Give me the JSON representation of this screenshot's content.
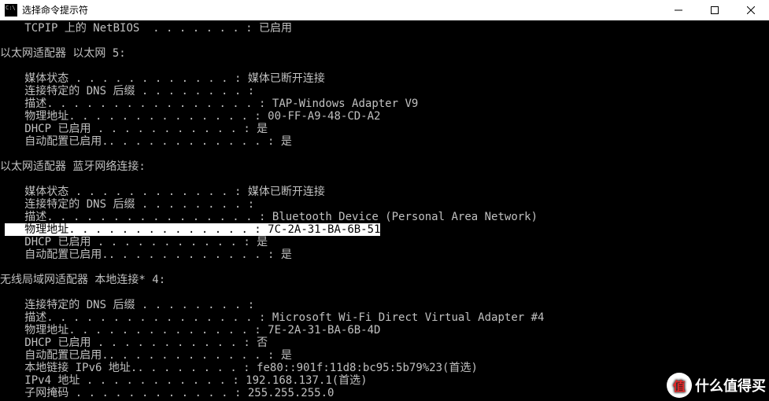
{
  "window": {
    "title": "选择命令提示符"
  },
  "top": {
    "netbios_label": "TCPIP 上的 NetBIOS",
    "netbios_value": "已启用"
  },
  "adapter_eth5": {
    "header": "以太网适配器 以太网 5:",
    "media_state_label": "媒体状态",
    "media_state_value": "媒体已断开连接",
    "dns_suffix_label": "连接特定的 DNS 后缀",
    "dns_suffix_value": "",
    "descr_label": "描述.",
    "descr_value": "TAP-Windows Adapter V9",
    "phys_label": "物理地址.",
    "phys_value": "00-FF-A9-48-CD-A2",
    "dhcp_label": "DHCP 已启用",
    "dhcp_value": "是",
    "autocfg_label": "自动配置已启用.",
    "autocfg_value": "是"
  },
  "adapter_bt": {
    "header": "以太网适配器 蓝牙网络连接:",
    "media_state_label": "媒体状态",
    "media_state_value": "媒体已断开连接",
    "dns_suffix_label": "连接特定的 DNS 后缀",
    "dns_suffix_value": "",
    "descr_label": "描述.",
    "descr_value": "Bluetooth Device (Personal Area Network)",
    "phys_label": "物理地址.",
    "phys_value": "7C-2A-31-BA-6B-51",
    "dhcp_label": "DHCP 已启用",
    "dhcp_value": "是",
    "autocfg_label": "自动配置已启用.",
    "autocfg_value": "是"
  },
  "adapter_wifi": {
    "header": "无线局域网适配器 本地连接* 4:",
    "dns_suffix_label": "连接特定的 DNS 后缀",
    "dns_suffix_value": "",
    "descr_label": "描述.",
    "descr_value": "Microsoft Wi-Fi Direct Virtual Adapter #4",
    "phys_label": "物理地址.",
    "phys_value": "7E-2A-31-BA-6B-4D",
    "dhcp_label": "DHCP 已启用",
    "dhcp_value": "否",
    "autocfg_label": "自动配置已启用.",
    "autocfg_value": "是",
    "ipv6_label": "本地链接 IPv6 地址.",
    "ipv6_value": "fe80::901f:11d8:bc95:5b79%23(首选)",
    "ipv4_label": "IPv4 地址",
    "ipv4_value": "192.168.137.1(首选)",
    "mask_label": "子网掩码",
    "mask_value": "255.255.255.0"
  },
  "dots_short": "  . . . . . . . : ",
  "dots_mid": " . . . . . . . . : ",
  "dots_mid2": ". . . . . . . . : ",
  "dots_a": " . . . . . . . . . . . . : ",
  "dots_b": " . . . . . . . . . . . : ",
  "dots_c": " . . . . . . . . . . . . . . . : ",
  "dots_d": " . . . . . . . . . . . . . : ",
  "dots_e": " . . . . . . . . . . : ",
  "dots_f": ". . . . . . . . . . . . : ",
  "indent": "   ",
  "watermark": {
    "badge": "值",
    "text": "什么值得买"
  }
}
